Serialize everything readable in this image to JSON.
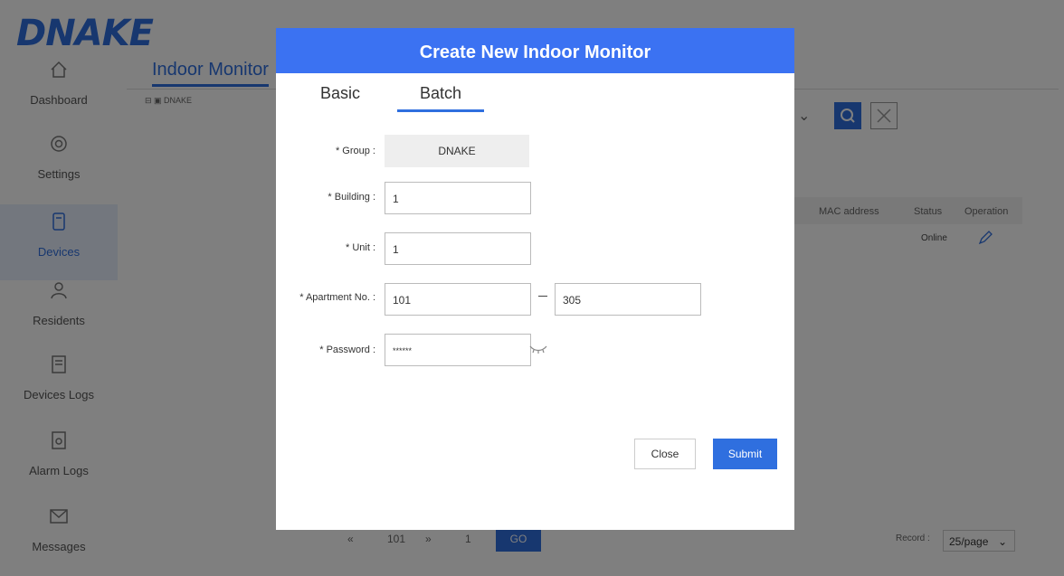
{
  "app": {
    "logo": "DNAKE",
    "page_title": "Indoor Monitor",
    "tree_node": "DNAKE",
    "accent": "#2f6fdf"
  },
  "sidebar": {
    "items": [
      {
        "label": "Dashboard",
        "icon": "home-icon"
      },
      {
        "label": "Settings",
        "icon": "gear-icon"
      },
      {
        "label": "Devices",
        "icon": "device-icon"
      },
      {
        "label": "Residents",
        "icon": "user-icon"
      },
      {
        "label": "Devices Logs",
        "icon": "log-icon"
      },
      {
        "label": "Alarm Logs",
        "icon": "alarm-log-icon"
      },
      {
        "label": "Messages",
        "icon": "mail-icon"
      }
    ]
  },
  "table": {
    "headers": [
      "MAC address",
      "Status",
      "Operation"
    ],
    "row_status": "Online"
  },
  "pager": {
    "first": "«",
    "prev": "101",
    "next": "»",
    "page": "1",
    "current": "GO",
    "records_label": "Record :",
    "per_page": "25/page"
  },
  "modal": {
    "title": "Create New Indoor Monitor",
    "tabs": [
      "Basic",
      "Batch"
    ],
    "active_tab": "Batch",
    "form": {
      "group_label": "* Group :",
      "group_value": "DNAKE",
      "building_label": "* Building :",
      "building_value": "1",
      "unit_label": "* Unit :",
      "unit_value": "1",
      "apartment_label": "* Apartment No. :",
      "apartment_from": "101",
      "apartment_to": "305",
      "password_label": "* Password :",
      "password_value": "******"
    },
    "close_label": "Close",
    "submit_label": "Submit"
  }
}
